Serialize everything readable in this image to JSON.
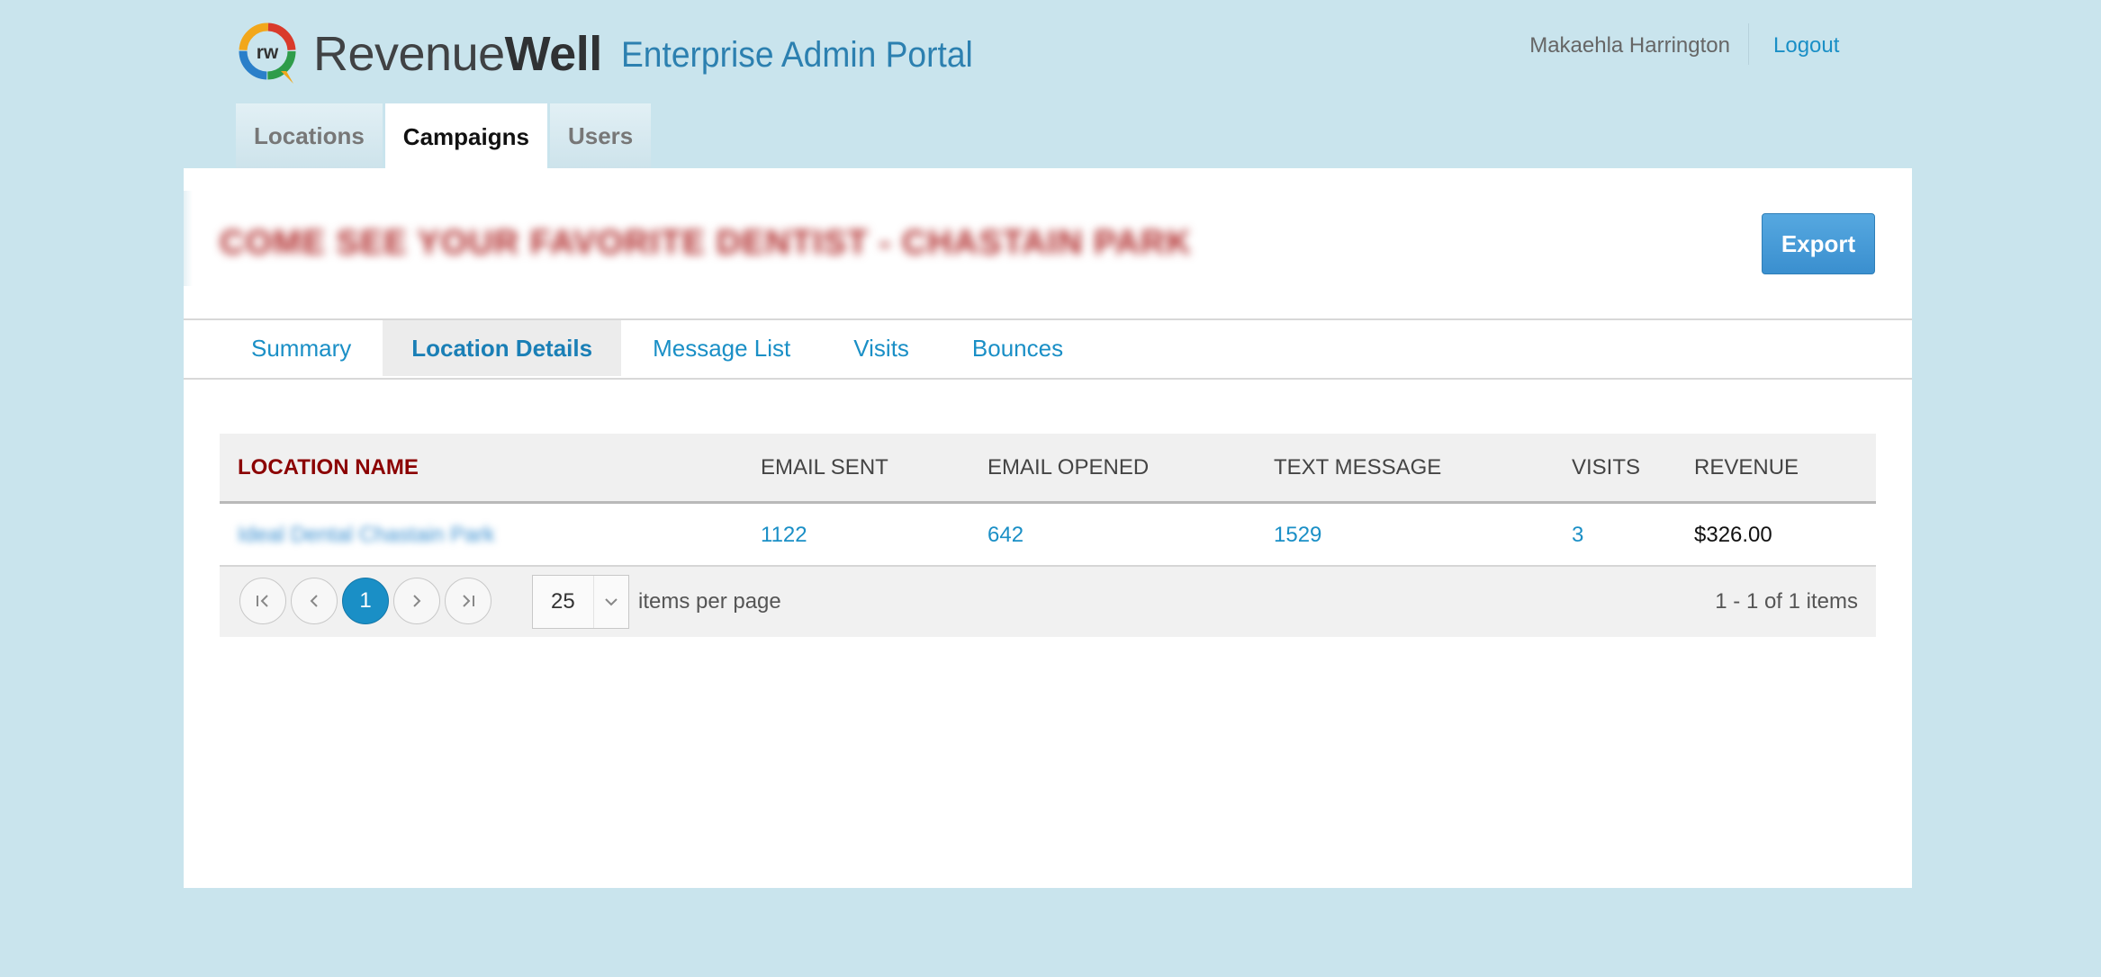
{
  "header": {
    "brand_light": "Revenue",
    "brand_bold": "Well",
    "logo_text": "rw",
    "portal_title": "Enterprise Admin Portal",
    "user_name": "Makaehla Harrington",
    "logout_label": "Logout"
  },
  "main_tabs": [
    {
      "label": "Locations",
      "active": false
    },
    {
      "label": "Campaigns",
      "active": true
    },
    {
      "label": "Users",
      "active": false
    }
  ],
  "campaign": {
    "title": "COME SEE YOUR FAVORITE DENTIST - CHASTAIN PARK",
    "export_label": "Export"
  },
  "sub_tabs": [
    {
      "label": "Summary",
      "active": false
    },
    {
      "label": "Location Details",
      "active": true
    },
    {
      "label": "Message List",
      "active": false
    },
    {
      "label": "Visits",
      "active": false
    },
    {
      "label": "Bounces",
      "active": false
    }
  ],
  "grid": {
    "columns": [
      "LOCATION NAME",
      "EMAIL SENT",
      "EMAIL OPENED",
      "TEXT MESSAGE",
      "VISITS",
      "REVENUE"
    ],
    "sorted_column": "LOCATION NAME",
    "rows": [
      {
        "location_name": "Ideal Dental Chastain Park",
        "email_sent": "1122",
        "email_opened": "642",
        "text_message": "1529",
        "visits": "3",
        "revenue": "$326.00"
      }
    ]
  },
  "pager": {
    "current_page": "1",
    "page_size": "25",
    "items_per_page_label": "items per page",
    "info": "1 - 1 of 1 items"
  },
  "colors": {
    "background": "#c9e4ed",
    "link": "#1a8fc6",
    "sorted_header": "#8b0000",
    "export_button": "#3a8fcf"
  }
}
